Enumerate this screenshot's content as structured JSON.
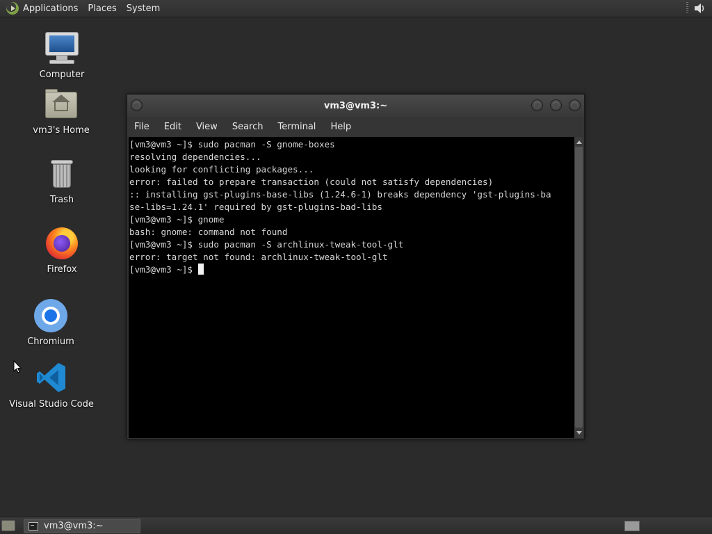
{
  "top_panel": {
    "menus": [
      "Applications",
      "Places",
      "System"
    ]
  },
  "desktop_icons": [
    {
      "label": "Computer",
      "icon": "computer-icon"
    },
    {
      "label": "vm3's Home",
      "icon": "home-folder-icon"
    },
    {
      "label": "Trash",
      "icon": "trash-icon"
    },
    {
      "label": "Firefox",
      "icon": "firefox-icon"
    },
    {
      "label": "Chromium",
      "icon": "chromium-icon"
    },
    {
      "label": "Visual Studio Code",
      "icon": "vscode-icon"
    }
  ],
  "terminal": {
    "title": "vm3@vm3:~",
    "menu": [
      "File",
      "Edit",
      "View",
      "Search",
      "Terminal",
      "Help"
    ],
    "lines": [
      "[vm3@vm3 ~]$ sudo pacman -S gnome-boxes",
      "resolving dependencies...",
      "looking for conflicting packages...",
      "error: failed to prepare transaction (could not satisfy dependencies)",
      ":: installing gst-plugins-base-libs (1.24.6-1) breaks dependency 'gst-plugins-ba",
      "se-libs=1.24.1' required by gst-plugins-bad-libs",
      "[vm3@vm3 ~]$ gnome",
      "bash: gnome: command not found",
      "[vm3@vm3 ~]$ sudo pacman -S archlinux-tweak-tool-glt",
      "error: target not found: archlinux-tweak-tool-glt"
    ],
    "prompt": "[vm3@vm3 ~]$ "
  },
  "bottom_panel": {
    "task_label": "vm3@vm3:~"
  }
}
